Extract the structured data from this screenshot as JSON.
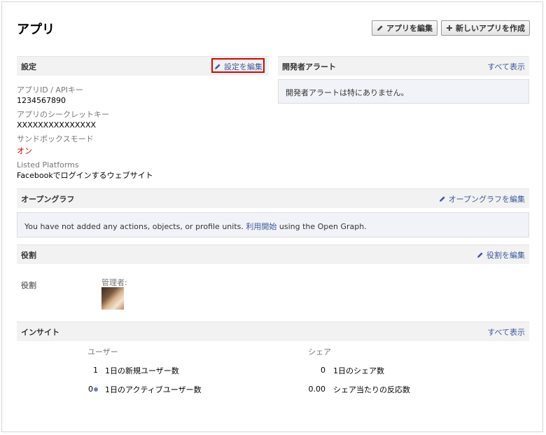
{
  "page": {
    "title": "アプリ",
    "edit_app_label": "アプリを編集",
    "new_app_label": "新しいアプリを作成"
  },
  "settings": {
    "header": "設定",
    "edit_label": "設定を編集",
    "app_id_label": "アプリID / APIキー",
    "app_id_value": "1234567890",
    "secret_label": "アプリのシークレットキー",
    "secret_value": "XXXXXXXXXXXXXXX",
    "sandbox_label": "サンドボックスモード",
    "sandbox_value": "オン",
    "platforms_label": "Listed Platforms",
    "platforms_value": "Facebookでログインするウェブサイト",
    "sandbox_color": "#c00000"
  },
  "alerts": {
    "header": "開発者アラート",
    "see_all": "すべて表示",
    "message": "開発者アラートは特にありません。"
  },
  "opengraph": {
    "header": "オープングラフ",
    "edit_label": "オープングラフを編集",
    "notice_prefix": "You have not added any actions, objects, or profile units.",
    "notice_link": "利用開始",
    "notice_suffix": "using the Open Graph."
  },
  "roles": {
    "header": "役割",
    "edit_label": "役割を編集",
    "row_label": "役割",
    "admins_label": "管理者:"
  },
  "insights": {
    "header": "インサイト",
    "see_all": "すべて表示",
    "users_header": "ユーザー",
    "share_header": "シェア",
    "new_users_value": "1",
    "new_users_label": "1日の新規ユーザー数",
    "active_users_value": "0",
    "active_users_label": "1日のアクティブユーザー数",
    "shares_value": "0",
    "shares_label": "1日のシェア数",
    "reaction_value": "0.00",
    "reaction_label": "シェア当たりの反応数"
  },
  "colors": {
    "link": "#3b5998",
    "highlight": "#e00000"
  },
  "icons": {
    "pencil": "pencil-icon",
    "plus": "plus-icon",
    "avatar": "admin-avatar"
  }
}
